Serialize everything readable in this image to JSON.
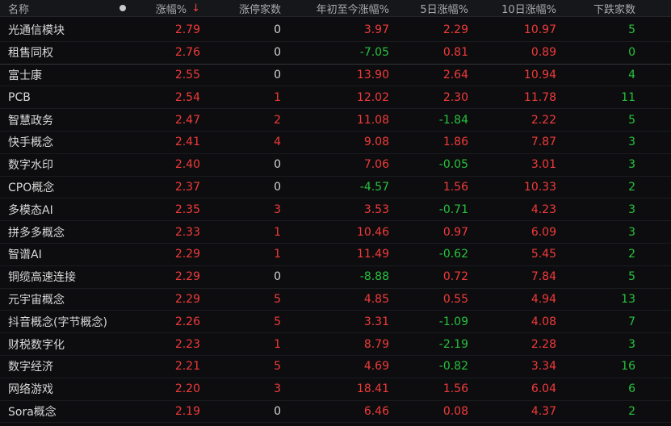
{
  "header": {
    "name": "名称",
    "change": "涨幅%",
    "sort_arrow": "↓",
    "limit_up": "涨停家数",
    "ytd": "年初至今涨幅%",
    "d5": "5日涨幅%",
    "d10": "10日涨幅%",
    "down": "下跌家数"
  },
  "colors": {
    "up": "#f23a3a",
    "down": "#26c23d",
    "neutral": "#d0d0d0",
    "background": "#0d0d0f"
  },
  "rows": [
    {
      "name": "光通信模块",
      "change": "2.79",
      "limit": "0",
      "ytd": "3.97",
      "d5": "2.29",
      "d10": "10.97",
      "down": "5"
    },
    {
      "name": "租售同权",
      "change": "2.76",
      "limit": "0",
      "ytd": "-7.05",
      "d5": "0.81",
      "d10": "0.89",
      "down": "0"
    },
    {
      "name": "富士康",
      "change": "2.55",
      "limit": "0",
      "ytd": "13.90",
      "d5": "2.64",
      "d10": "10.94",
      "down": "4"
    },
    {
      "name": "PCB",
      "change": "2.54",
      "limit": "1",
      "ytd": "12.02",
      "d5": "2.30",
      "d10": "11.78",
      "down": "11"
    },
    {
      "name": "智慧政务",
      "change": "2.47",
      "limit": "2",
      "ytd": "11.08",
      "d5": "-1.84",
      "d10": "2.22",
      "down": "5"
    },
    {
      "name": "快手概念",
      "change": "2.41",
      "limit": "4",
      "ytd": "9.08",
      "d5": "1.86",
      "d10": "7.87",
      "down": "3"
    },
    {
      "name": "数字水印",
      "change": "2.40",
      "limit": "0",
      "ytd": "7.06",
      "d5": "-0.05",
      "d10": "3.01",
      "down": "3"
    },
    {
      "name": "CPO概念",
      "change": "2.37",
      "limit": "0",
      "ytd": "-4.57",
      "d5": "1.56",
      "d10": "10.33",
      "down": "2"
    },
    {
      "name": "多模态AI",
      "change": "2.35",
      "limit": "3",
      "ytd": "3.53",
      "d5": "-0.71",
      "d10": "4.23",
      "down": "3"
    },
    {
      "name": "拼多多概念",
      "change": "2.33",
      "limit": "1",
      "ytd": "10.46",
      "d5": "0.97",
      "d10": "6.09",
      "down": "3"
    },
    {
      "name": "智谱AI",
      "change": "2.29",
      "limit": "1",
      "ytd": "11.49",
      "d5": "-0.62",
      "d10": "5.45",
      "down": "2"
    },
    {
      "name": "铜缆高速连接",
      "change": "2.29",
      "limit": "0",
      "ytd": "-8.88",
      "d5": "0.72",
      "d10": "7.84",
      "down": "5"
    },
    {
      "name": "元宇宙概念",
      "change": "2.29",
      "limit": "5",
      "ytd": "4.85",
      "d5": "0.55",
      "d10": "4.94",
      "down": "13"
    },
    {
      "name": "抖音概念(字节概念)",
      "change": "2.26",
      "limit": "5",
      "ytd": "3.31",
      "d5": "-1.09",
      "d10": "4.08",
      "down": "7"
    },
    {
      "name": "财税数字化",
      "change": "2.23",
      "limit": "1",
      "ytd": "8.79",
      "d5": "-2.19",
      "d10": "2.28",
      "down": "3"
    },
    {
      "name": "数字经济",
      "change": "2.21",
      "limit": "5",
      "ytd": "4.69",
      "d5": "-0.82",
      "d10": "3.34",
      "down": "16"
    },
    {
      "name": "网络游戏",
      "change": "2.20",
      "limit": "3",
      "ytd": "18.41",
      "d5": "1.56",
      "d10": "6.04",
      "down": "6"
    },
    {
      "name": "Sora概念",
      "change": "2.19",
      "limit": "0",
      "ytd": "6.46",
      "d5": "0.08",
      "d10": "4.37",
      "down": "2"
    }
  ]
}
